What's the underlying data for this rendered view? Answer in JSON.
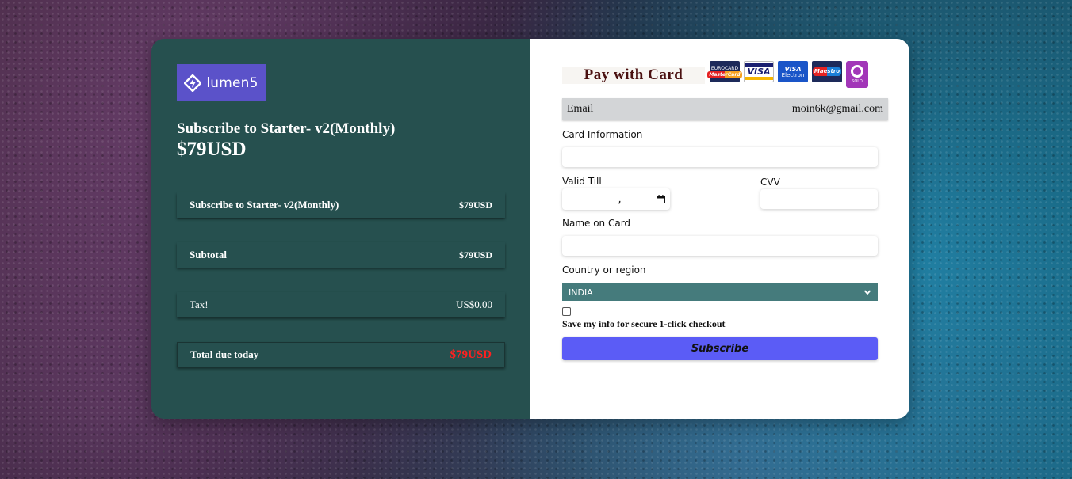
{
  "brand": {
    "logo_text": "lumen5",
    "logo_color": "#5b52c9"
  },
  "summary": {
    "plan_title": "Subscribe to Starter- v2(Monthly)",
    "plan_price": "$79USD",
    "rows": [
      {
        "label": "Subscribe to Starter- v2(Monthly)",
        "value": "$79USD"
      },
      {
        "label": "Subtotal",
        "value": "$79USD"
      },
      {
        "label": "Tax!",
        "value": "US$0.00"
      },
      {
        "label": "Total due today",
        "value": "$79USD"
      }
    ]
  },
  "payment": {
    "title": "Pay with Card",
    "card_logos": [
      {
        "icon": "eurocard-mastercard-icon",
        "top": "EUROCARD",
        "bottom": "MasterCard"
      },
      {
        "icon": "visa-icon",
        "bottom": "VISA"
      },
      {
        "icon": "visa-electron-icon",
        "top": "VISA",
        "bottom": "Electron"
      },
      {
        "icon": "maestro-icon",
        "bottom": "Maestro"
      },
      {
        "icon": "solo-icon",
        "bottom": "SOLO"
      }
    ],
    "email_label": "Email",
    "email_value": "moin6k@gmail.com",
    "card_info_label": "Card Information",
    "card_info_value": "",
    "valid_till_label": "Valid Till",
    "valid_till_value": "---------, ----",
    "cvv_label": "CVV",
    "cvv_value": "",
    "name_label": "Name on Card",
    "name_value": "",
    "country_label": "Country or region",
    "country_value": "INDIA",
    "save_info_label": "Save my info for secure 1-click checkout",
    "save_info_checked": false,
    "subscribe_label": "Subscribe"
  },
  "colors": {
    "left_panel": "#26504f",
    "total_value": "#ff2020",
    "subscribe_button": "#5b5cf6",
    "country_select": "#457b7c"
  }
}
